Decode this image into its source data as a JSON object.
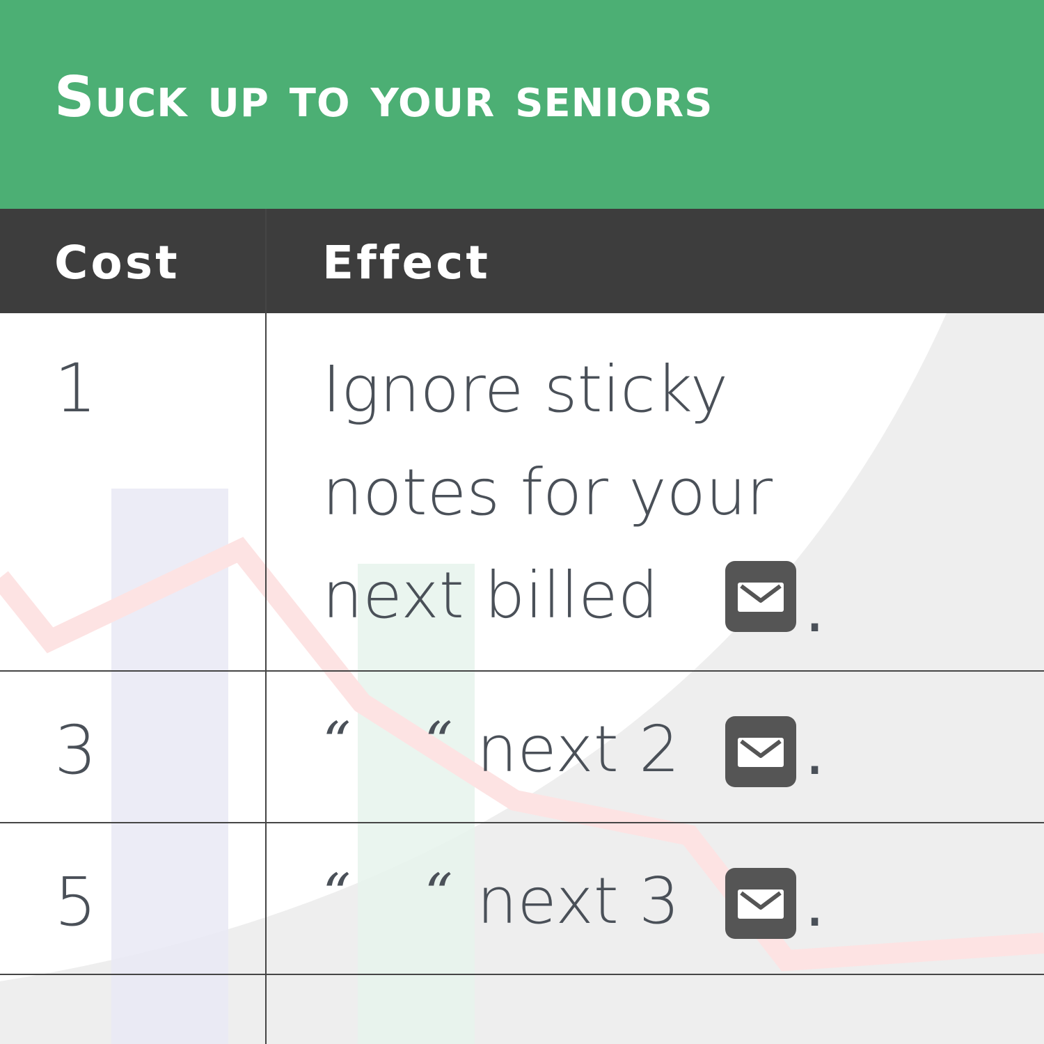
{
  "title": "Suck up to your seniors",
  "colors": {
    "title_background": "#4caf74",
    "header_background": "#3d3d3d",
    "header_text": "#ffffff",
    "body_text": "#4a5058",
    "icon_background": "#555555"
  },
  "table": {
    "headers": {
      "cost": "Cost",
      "effect": "Effect"
    },
    "rows": [
      {
        "cost": "1",
        "effect_lines": [
          "Ignore sticky",
          "notes for your",
          "next billed"
        ],
        "icon": "mail-icon",
        "period": "."
      },
      {
        "cost": "3",
        "ditto": "“ “",
        "effect": "next 2",
        "icon": "mail-icon",
        "period": "."
      },
      {
        "cost": "5",
        "ditto": "“ “",
        "effect": "next 3",
        "icon": "mail-icon",
        "period": "."
      }
    ]
  }
}
